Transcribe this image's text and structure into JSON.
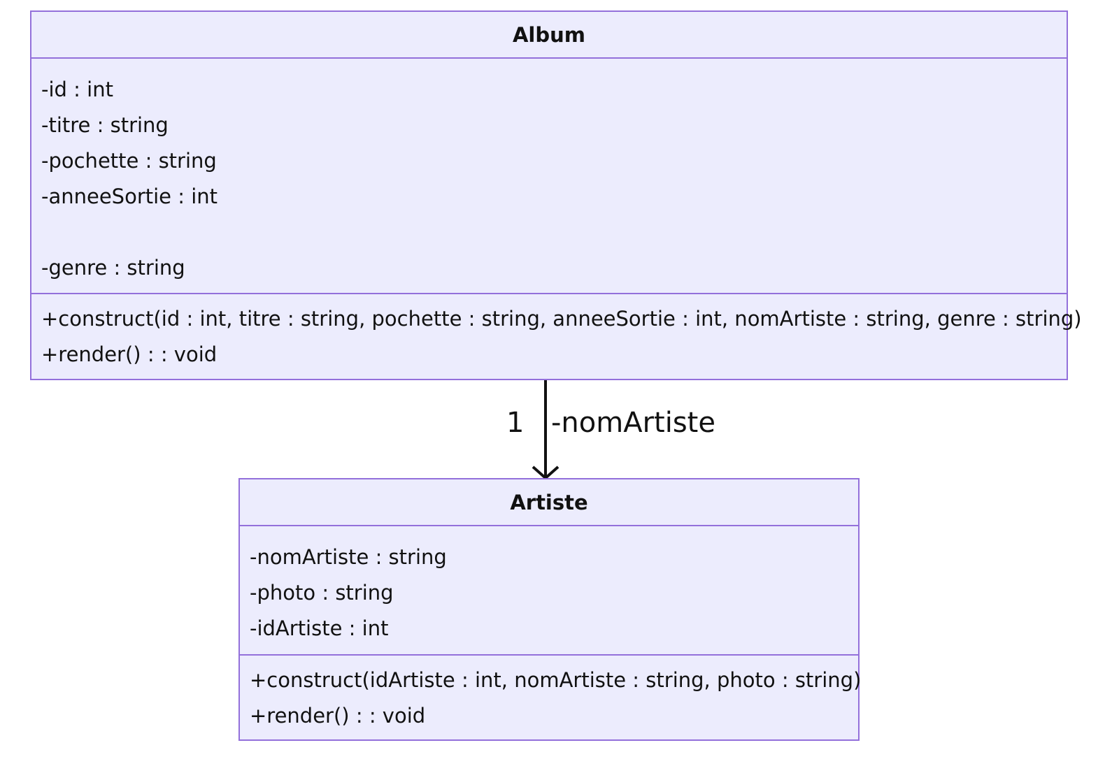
{
  "album": {
    "name": "Album",
    "attributes": [
      "-id : int",
      "-titre : string",
      "-pochette : string",
      "-anneeSortie : int",
      "",
      "-genre : string"
    ],
    "methods": [
      "+construct(id : int, titre : string, pochette : string, anneeSortie : int, nomArtiste : string, genre : string)",
      "+render() : : void"
    ]
  },
  "artiste": {
    "name": "Artiste",
    "attributes": [
      "-nomArtiste : string",
      "-photo : string",
      "-idArtiste : int"
    ],
    "methods": [
      "+construct(idArtiste : int, nomArtiste : string, photo : string)",
      "+render() : : void"
    ]
  },
  "relation": {
    "multiplicity": "1",
    "role": "-nomArtiste"
  },
  "colors": {
    "class_fill": "#ececfd",
    "class_border": "#9370db",
    "arrow": "#111111"
  }
}
